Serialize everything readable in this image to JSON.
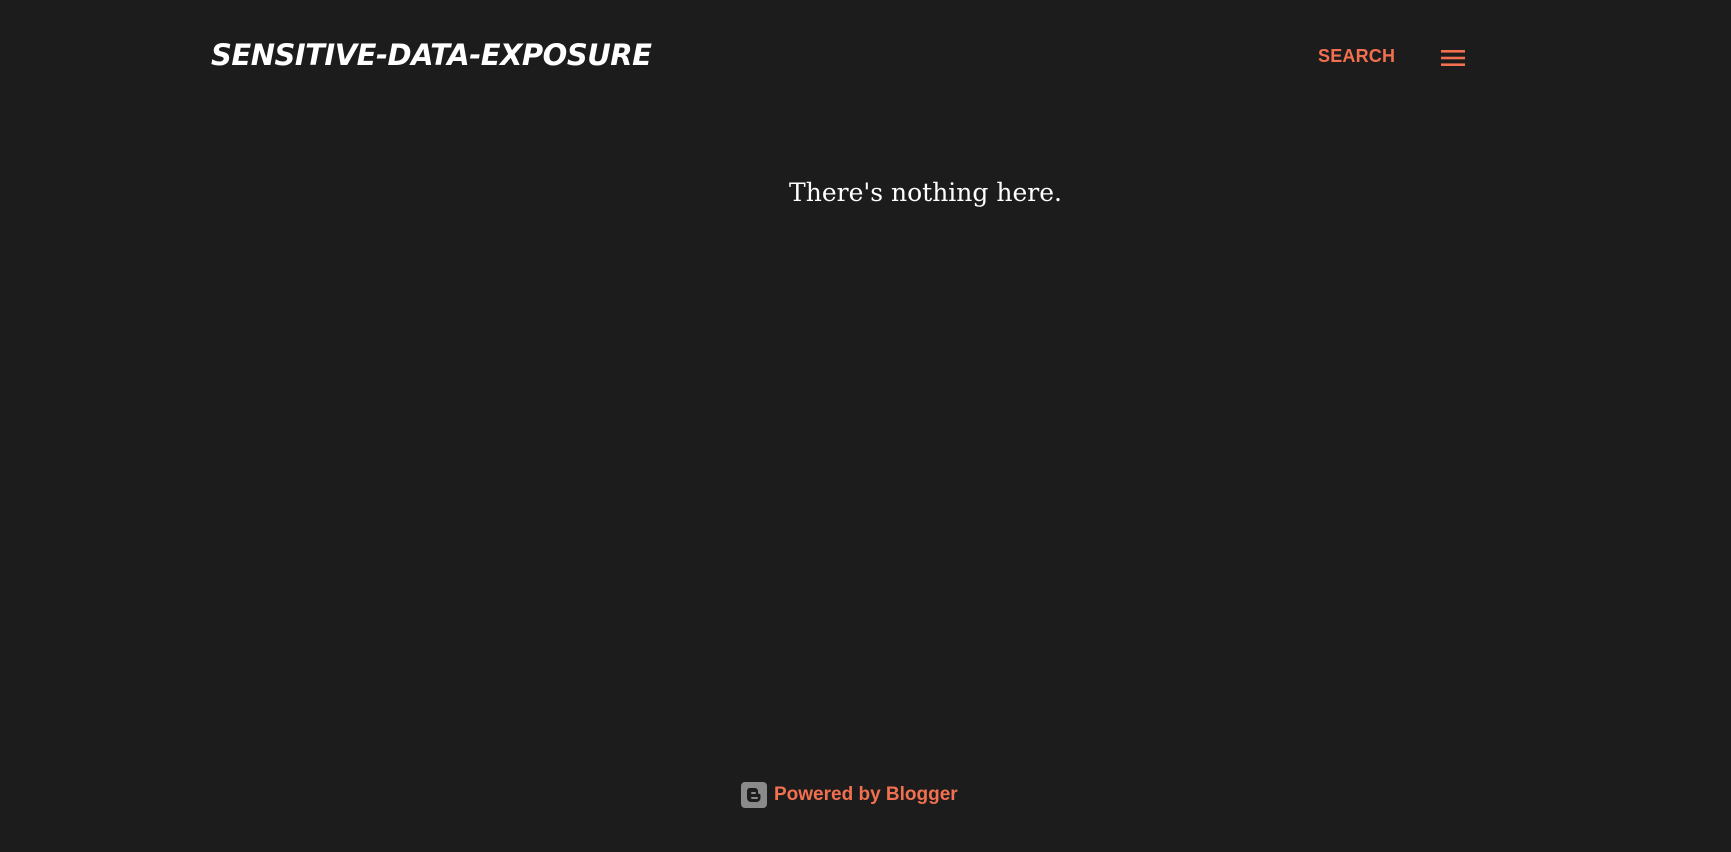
{
  "header": {
    "blog_title": "SENSITIVE-DATA-EXPOSURE",
    "search_label": "SEARCH",
    "menu_icon": "hamburger-menu-icon"
  },
  "main": {
    "empty_message": "There's nothing here."
  },
  "footer": {
    "powered_by_label": "Powered by Blogger",
    "blogger_icon": "blogger-logo-icon"
  },
  "colors": {
    "background": "#1c1c1c",
    "accent": "#f2704f",
    "title_text": "#ffffff",
    "icon_gray": "#8a8a8a"
  }
}
